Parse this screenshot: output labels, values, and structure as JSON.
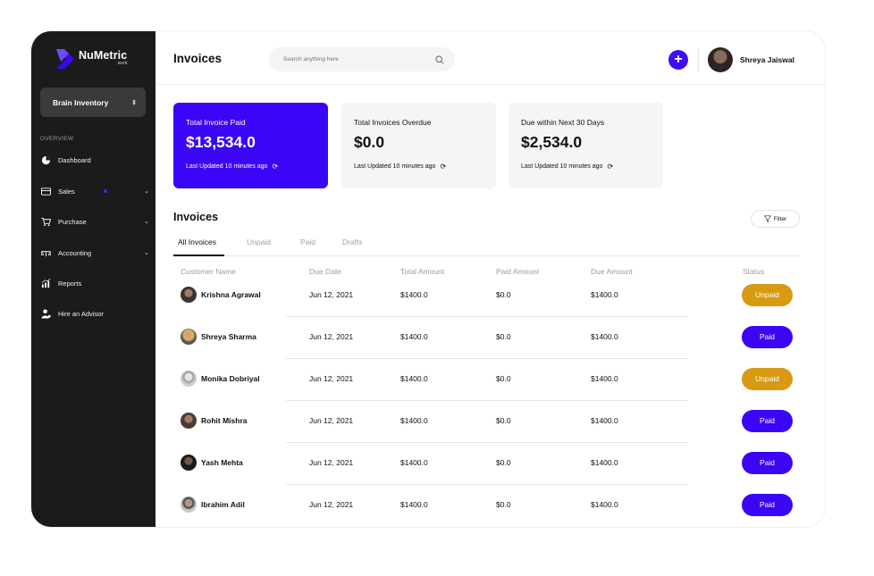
{
  "brand": {
    "name": "NuMetric",
    "sub": ".work",
    "color": "#3a06f5"
  },
  "sidebar": {
    "workspace": "Brain Inventory",
    "section_label": "OVERVIEW",
    "items": [
      {
        "label": "Dashboard",
        "icon": "pie-chart-icon"
      },
      {
        "label": "Sales",
        "icon": "card-icon"
      },
      {
        "label": "Purchase",
        "icon": "cart-icon"
      },
      {
        "label": "Accounting",
        "icon": "scale-icon"
      },
      {
        "label": "Reports",
        "icon": "chart-icon"
      },
      {
        "label": "Hire an Advisor",
        "icon": "person-icon"
      }
    ]
  },
  "header": {
    "title": "Invoices",
    "search_placeholder": "Search anything here",
    "user_name": "Shreya Jaiswal"
  },
  "cards": [
    {
      "title": "Total Invoice Paid",
      "amount": "$13,534.0",
      "updated": "Last Updated 10 minutes ago"
    },
    {
      "title": "Total Invoices Overdue",
      "amount": "$0.0",
      "updated": "Last Updated 10 minutes ago"
    },
    {
      "title": "Due within Next 30 Days",
      "amount": "$2,534.0",
      "updated": "Last Updated 10 minutes ago"
    }
  ],
  "invoices": {
    "title": "Invoices",
    "filter_label": "Filter",
    "tabs": [
      "All Invoices",
      "Unpaid",
      "Paid",
      "Drafts"
    ],
    "columns": [
      "Customer Name",
      "Due Date",
      "Total Amount",
      "Paid Amount",
      "Due Amount",
      "Status"
    ],
    "rows": [
      {
        "name": "Krishna Agrawal",
        "due_date": "Jun 12, 2021",
        "total": "$1400.0",
        "paid": "$0.0",
        "due": "$1400.0",
        "status": "Unpaid"
      },
      {
        "name": "Shreya Sharma",
        "due_date": "Jun 12, 2021",
        "total": "$1400.0",
        "paid": "$0.0",
        "due": "$1400.0",
        "status": "Paid"
      },
      {
        "name": "Monika Dobriyal",
        "due_date": "Jun 12, 2021",
        "total": "$1400.0",
        "paid": "$0.0",
        "due": "$1400.0",
        "status": "Unpaid"
      },
      {
        "name": "Rohit Mishra",
        "due_date": "Jun 12, 2021",
        "total": "$1400.0",
        "paid": "$0.0",
        "due": "$1400.0",
        "status": "Paid"
      },
      {
        "name": "Yash Mehta",
        "due_date": "Jun 12, 2021",
        "total": "$1400.0",
        "paid": "$0.0",
        "due": "$1400.0",
        "status": "Paid"
      },
      {
        "name": "Ibrahim Adil",
        "due_date": "Jun 12, 2021",
        "total": "$1400.0",
        "paid": "$0.0",
        "due": "$1400.0",
        "status": "Paid"
      }
    ]
  },
  "colors": {
    "paid": "#3a06f5",
    "unpaid": "#d79a11",
    "sidebar": "#1b1b1b"
  }
}
